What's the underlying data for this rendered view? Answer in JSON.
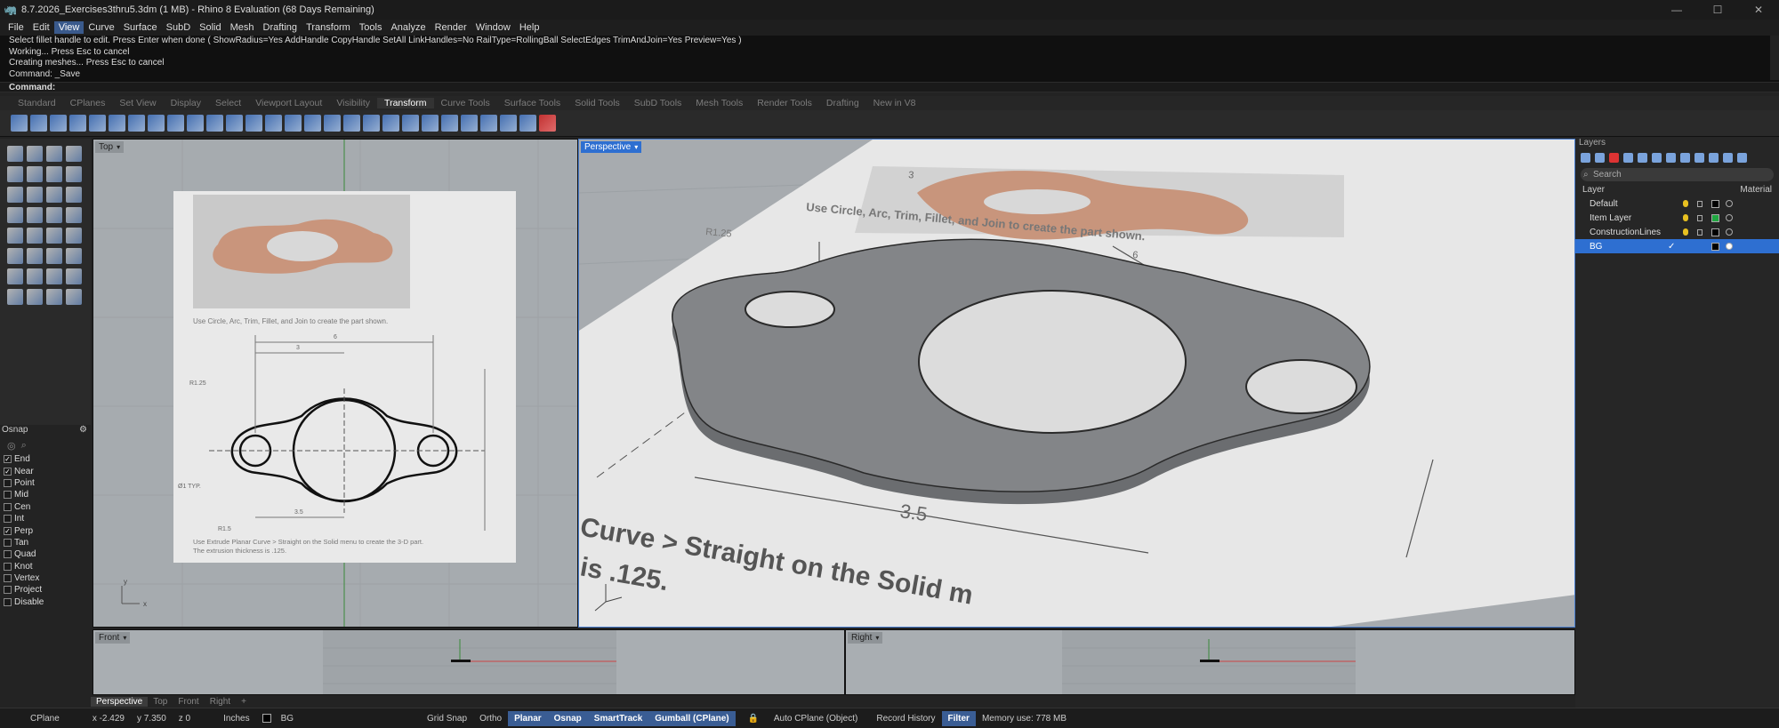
{
  "window": {
    "title": "8.7.2026_Exercises3thru5.3dm (1 MB) - Rhino 8 Evaluation (68 Days Remaining)",
    "controls": [
      "—",
      "☐",
      "✕"
    ]
  },
  "menu": [
    "File",
    "Edit",
    "View",
    "Curve",
    "Surface",
    "SubD",
    "Solid",
    "Mesh",
    "Drafting",
    "Transform",
    "Tools",
    "Analyze",
    "Render",
    "Window",
    "Help"
  ],
  "menu_active": "View",
  "command_history": [
    "Select fillet handle to edit. Press Enter when done ( ShowRadius=Yes  AddHandle  CopyHandle  SetAll  LinkHandles=No  RailType=RollingBall  SelectEdges  TrimAndJoin=Yes  Preview=Yes )",
    "Working... Press Esc to cancel",
    "Creating meshes... Press Esc to cancel",
    "Command: _Save"
  ],
  "command_prompt": "Command:",
  "toolbar_tabs": [
    "Standard",
    "CPlanes",
    "Set View",
    "Display",
    "Select",
    "Viewport Layout",
    "Visibility",
    "Transform",
    "Curve Tools",
    "Surface Tools",
    "Solid Tools",
    "SubD Tools",
    "Mesh Tools",
    "Render Tools",
    "Drafting",
    "New in V8"
  ],
  "toolbar_tab_active": "Transform",
  "osnap": {
    "title": "Osnap",
    "items": [
      {
        "label": "End",
        "checked": true
      },
      {
        "label": "Near",
        "checked": true
      },
      {
        "label": "Point",
        "checked": false
      },
      {
        "label": "Mid",
        "checked": false
      },
      {
        "label": "Cen",
        "checked": false
      },
      {
        "label": "Int",
        "checked": false
      },
      {
        "label": "Perp",
        "checked": true
      },
      {
        "label": "Tan",
        "checked": false
      },
      {
        "label": "Quad",
        "checked": false
      },
      {
        "label": "Knot",
        "checked": false
      },
      {
        "label": "Vertex",
        "checked": false
      },
      {
        "label": "Project",
        "checked": false
      },
      {
        "label": "Disable",
        "checked": false
      }
    ]
  },
  "viewports": {
    "top": "Top",
    "perspective": "Perspective",
    "front": "Front",
    "right": "Right"
  },
  "drawing": {
    "instruction1": "Use Circle, Arc, Trim, Fillet, and Join to create the part shown.",
    "instruction2": "Use Extrude Planar Curve > Straight on the Solid menu to create the 3-D part.",
    "instruction3": "The extrusion thickness is .125.",
    "dim_6": "6",
    "dim_3": "3",
    "dim_35": "3.5",
    "r125": "R1.25",
    "r15": "R1.5",
    "d1typ": "Ø1 TYP.",
    "persp_text1": "Curve > Straight on the Solid m",
    "persp_text2": "is .125.",
    "persp_dim_35": "3.5",
    "persp_dim_3": "3",
    "persp_dim_6": "6",
    "persp_r125": "R1.25",
    "persp_instruction": "Use Circle, Arc, Trim, Fillet, and Join to create the part shown."
  },
  "layers": {
    "title": "Layers",
    "search_placeholder": "Search",
    "col_layer": "Layer",
    "col_material": "Material",
    "items": [
      {
        "name": "Default",
        "color": "#000000",
        "selected": false
      },
      {
        "name": "Item Layer",
        "color": "#1fa640",
        "selected": false
      },
      {
        "name": "ConstructionLines",
        "color": "#000000",
        "selected": false
      },
      {
        "name": "BG",
        "color": "#000000",
        "selected": true
      }
    ]
  },
  "viewport_tabs": [
    "Perspective",
    "Top",
    "Front",
    "Right",
    "+"
  ],
  "viewport_tab_active": "Perspective",
  "status": {
    "cplane": "CPlane",
    "x": "x -2.429",
    "y": "y 7.350",
    "z": "z 0",
    "units": "Inches",
    "layer": "BG",
    "toggles": [
      {
        "label": "Grid Snap",
        "on": false
      },
      {
        "label": "Ortho",
        "on": false
      },
      {
        "label": "Planar",
        "on": true
      },
      {
        "label": "Osnap",
        "on": true
      },
      {
        "label": "SmartTrack",
        "on": true
      },
      {
        "label": "Gumball (CPlane)",
        "on": true
      }
    ],
    "autocplane": "Auto CPlane (Object)",
    "record_history": "Record History",
    "filter": "Filter",
    "memory": "Memory use: 778 MB"
  }
}
